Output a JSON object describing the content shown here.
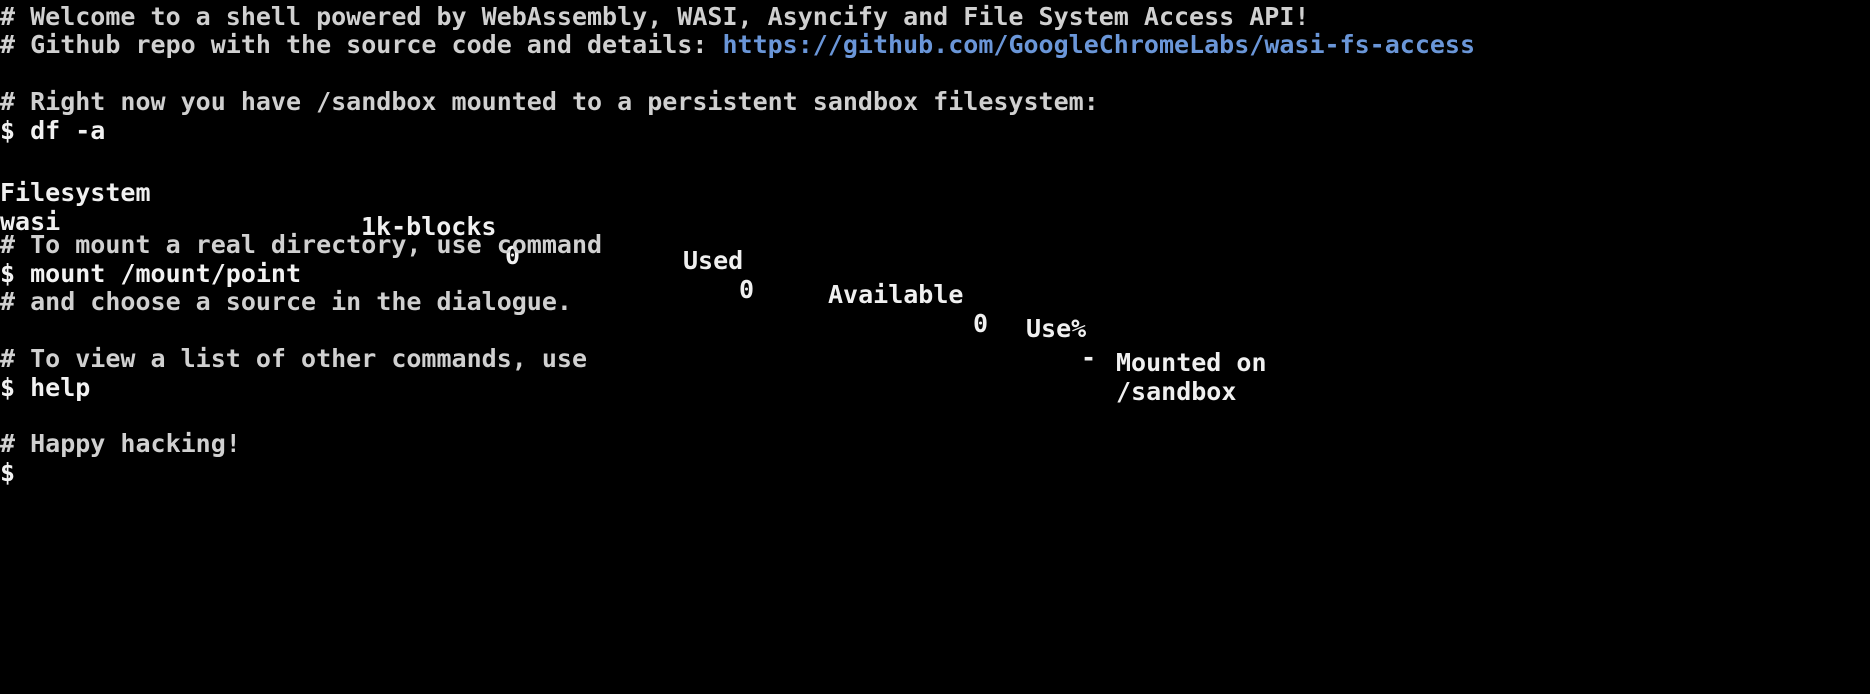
{
  "terminal": {
    "lines": {
      "welcome": "# Welcome to a shell powered by WebAssembly, WASI, Asyncify and File System Access API!",
      "repo_prefix": "# Github repo with the source code and details: ",
      "repo_link": "https://github.com/GoogleChromeLabs/wasi-fs-access",
      "sandbox_note": "# Right now you have /sandbox mounted to a persistent sandbox filesystem:",
      "df_command": "$ df -a",
      "mount_note": "# To mount a real directory, use command",
      "mount_command": "$ mount /mount/point",
      "dialogue_note": "# and choose a source in the dialogue.",
      "help_note": "# To view a list of other commands, use",
      "help_command": "$ help",
      "happy": "# Happy hacking!",
      "prompt": "$"
    },
    "df_table": {
      "headers": [
        "Filesystem",
        "1k-blocks",
        "Used",
        "Available",
        "Use%",
        "Mounted on"
      ],
      "rows": [
        [
          "wasi",
          "0",
          "0",
          "0",
          "-",
          "/sandbox"
        ]
      ]
    },
    "colors": {
      "background": "#000000",
      "text": "#d9d9d9",
      "link": "#6a96d8"
    }
  }
}
